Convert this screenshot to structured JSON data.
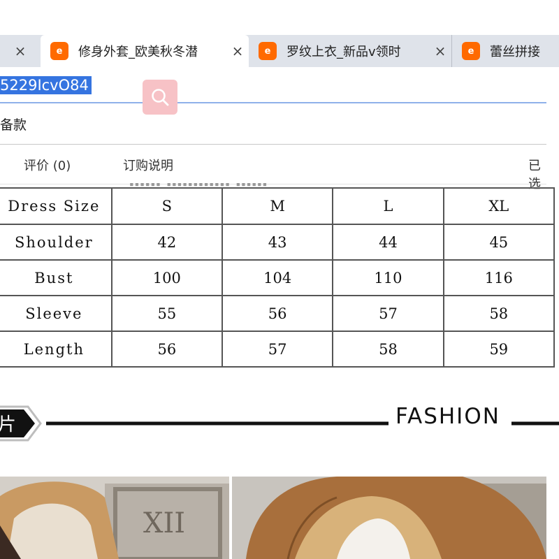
{
  "browser": {
    "tabs": [
      {
        "close": "×"
      },
      {
        "logo": "e",
        "title": "修身外套_欧美秋冬潜",
        "close": "×"
      },
      {
        "logo": "e",
        "title": "罗纹上衣_新品v领时",
        "close": "×"
      },
      {
        "logo": "e",
        "title": "蕾丝拼接"
      }
    ],
    "address_selected": "5229IcvO84"
  },
  "page": {
    "subtitle": "备款",
    "nav": [
      "评价 (0)",
      "订购说明",
      "已选"
    ]
  },
  "size_table": {
    "header": [
      "Dress Size",
      "S",
      "M",
      "L",
      "XL"
    ],
    "rows": [
      {
        "label": "Shoulder",
        "values": [
          "42",
          "43",
          "44",
          "45"
        ]
      },
      {
        "label": "Bust",
        "values": [
          "100",
          "104",
          "110",
          "116"
        ]
      },
      {
        "label": "Sleeve",
        "values": [
          "55",
          "56",
          "57",
          "58"
        ]
      },
      {
        "label": "Length",
        "values": [
          "56",
          "57",
          "58",
          "59"
        ]
      }
    ]
  },
  "section": {
    "badge": "片",
    "label": "FASHION"
  },
  "colors": {
    "accent_orange": "#ff6a00",
    "selection_blue": "#3574e0",
    "search_pink": "#f7c2c6"
  },
  "icons": [
    "alibaba-logo-icon",
    "close-icon",
    "search-icon"
  ]
}
